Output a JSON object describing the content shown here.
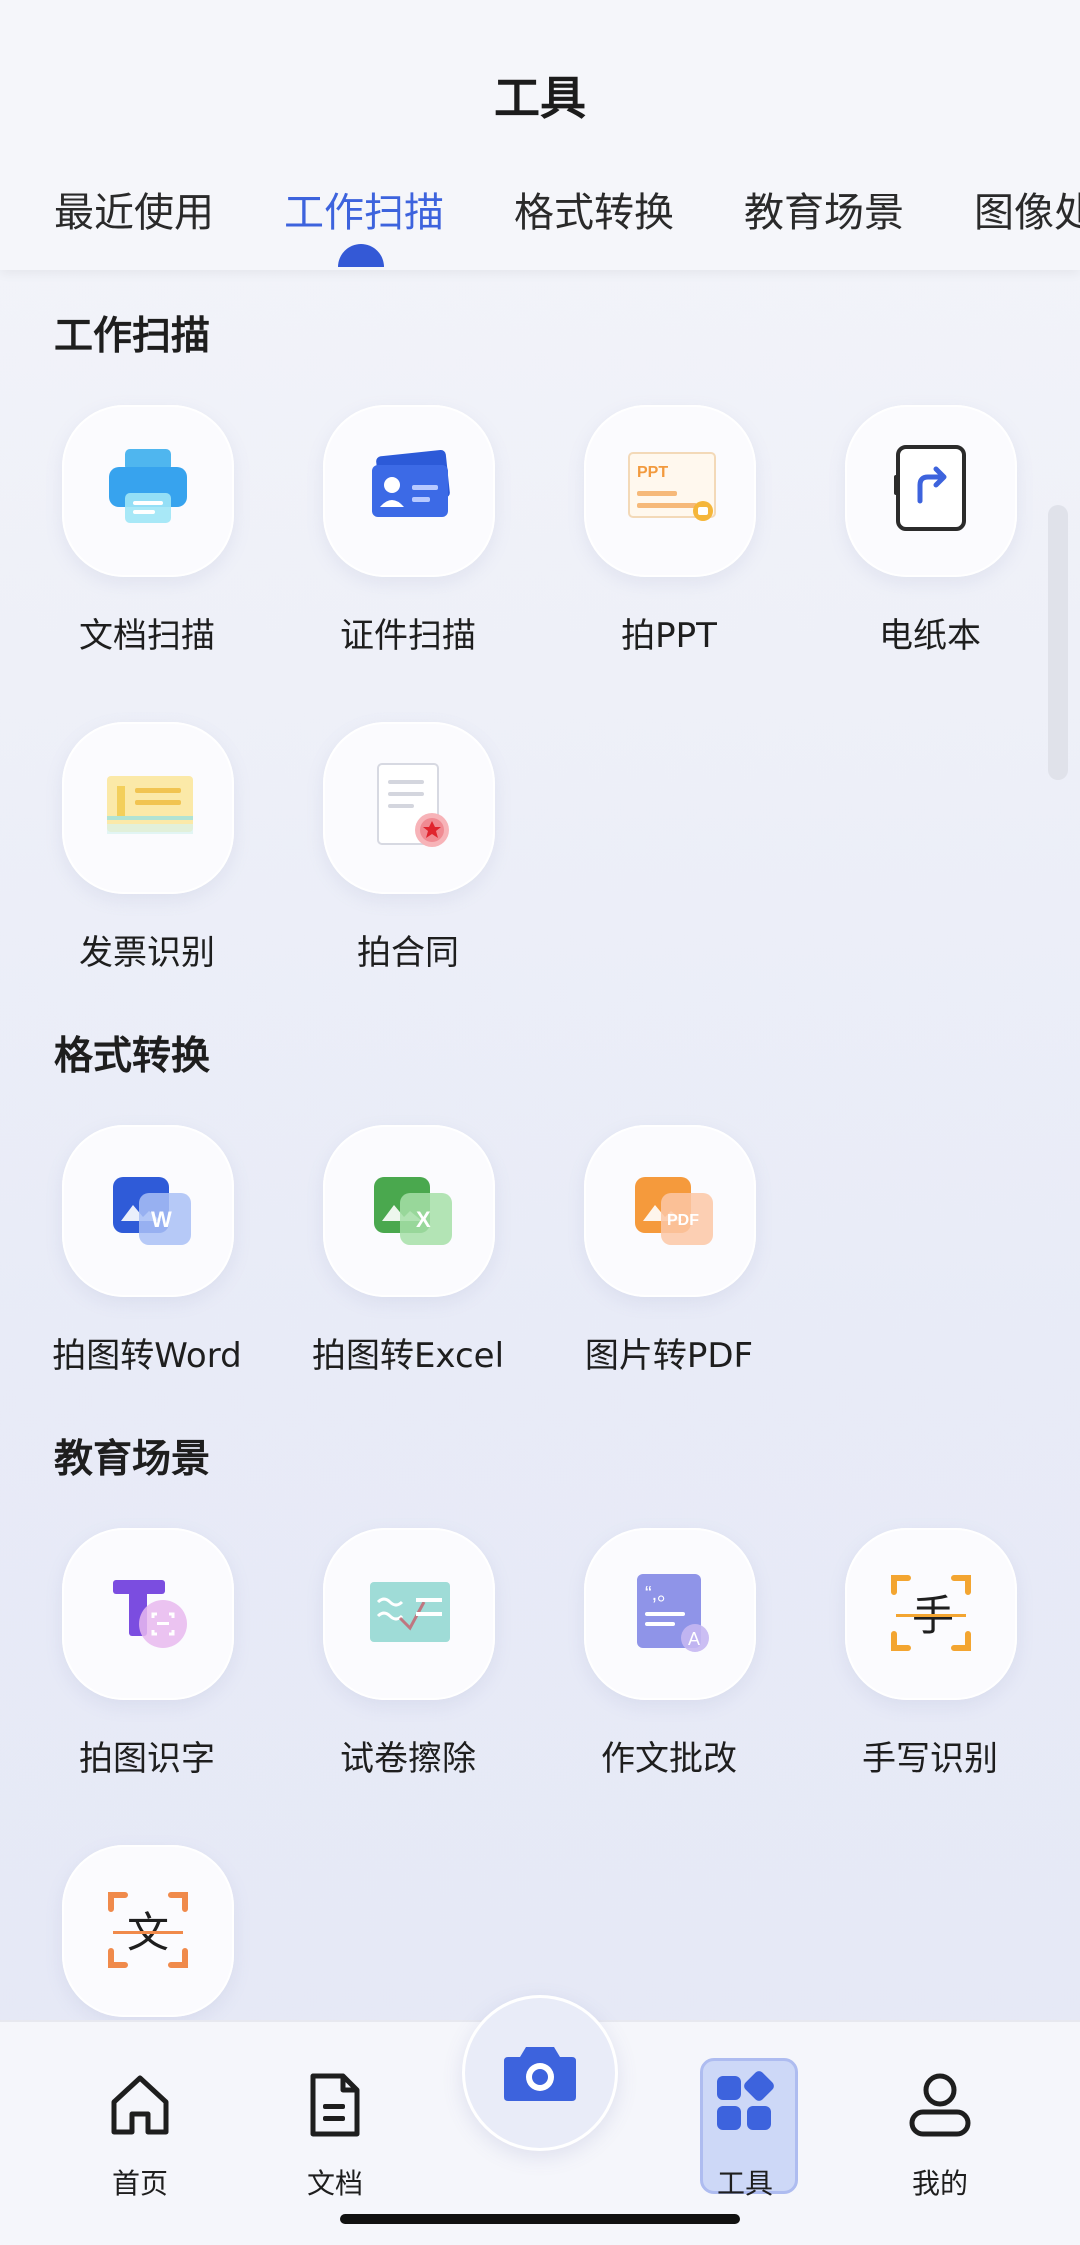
{
  "header": {
    "title": "工具",
    "tabs": [
      {
        "label": "最近使用"
      },
      {
        "label": "工作扫描"
      },
      {
        "label": "格式转换"
      },
      {
        "label": "教育场景"
      },
      {
        "label": "图像处"
      }
    ]
  },
  "sections": {
    "work_scan": {
      "title": "工作扫描",
      "items": [
        {
          "label": "文档扫描",
          "icon": "printer-icon"
        },
        {
          "label": "证件扫描",
          "icon": "id-card-icon"
        },
        {
          "label": "拍PPT",
          "icon": "ppt-icon"
        },
        {
          "label": "电纸本",
          "icon": "e-paper-icon"
        },
        {
          "label": "发票识别",
          "icon": "invoice-icon"
        },
        {
          "label": "拍合同",
          "icon": "contract-icon"
        }
      ]
    },
    "format": {
      "title": "格式转换",
      "items": [
        {
          "label": "拍图转Word",
          "icon": "word-icon"
        },
        {
          "label": "拍图转Excel",
          "icon": "excel-icon"
        },
        {
          "label": "图片转PDF",
          "icon": "pdf-icon"
        }
      ]
    },
    "education": {
      "title": "教育场景",
      "items": [
        {
          "label": "拍图识字",
          "icon": "text-recognize-icon"
        },
        {
          "label": "试卷擦除",
          "icon": "exam-erase-icon"
        },
        {
          "label": "作文批改",
          "icon": "essay-correct-icon"
        },
        {
          "label": "手写识别",
          "icon": "handwriting-icon"
        },
        {
          "label": "",
          "icon": "translate-icon"
        }
      ]
    }
  },
  "bottom_nav": {
    "items": [
      {
        "label": "首页",
        "icon": "home-icon"
      },
      {
        "label": "文档",
        "icon": "document-icon"
      },
      {
        "label": "工具",
        "icon": "tools-icon"
      },
      {
        "label": "我的",
        "icon": "user-icon"
      }
    ],
    "camera_icon": "camera-icon"
  },
  "colors": {
    "accent": "#3d63dd",
    "background": "#eef0f8"
  }
}
